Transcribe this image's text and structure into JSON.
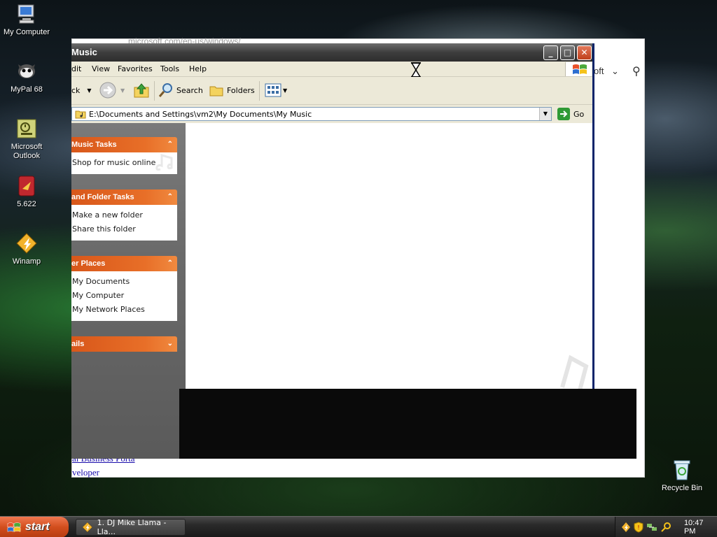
{
  "desktop": {
    "icons": [
      {
        "label": "My Computer",
        "icon": "computer-icon"
      },
      {
        "label": "MyPal 68",
        "icon": "mypal-icon"
      },
      {
        "label": "Microsoft Outlook",
        "icon": "outlook-icon"
      },
      {
        "label": "5.622",
        "icon": "app-icon"
      },
      {
        "label": "Winamp",
        "icon": "winamp-icon"
      },
      {
        "label": "Recycle Bin",
        "icon": "recycle-bin-icon"
      }
    ]
  },
  "background_browser": {
    "address_fragment": "microsoft.com/en-us/windows/",
    "header_fragment": "oft",
    "link_fragments": [
      "al Business Porta",
      "veloper"
    ]
  },
  "explorer": {
    "title": "Music",
    "menu": [
      "dit",
      "View",
      "Favorites",
      "Tools",
      "Help"
    ],
    "toolbar": {
      "back_label": "ck",
      "search_label": "Search",
      "folders_label": "Folders"
    },
    "address": {
      "value": "E:\\Documents and Settings\\vm2\\My Documents\\My Music",
      "go_label": "Go"
    },
    "panels": [
      {
        "title": "Music Tasks",
        "links": [
          "Shop for music online"
        ],
        "collapsed": false
      },
      {
        "title": "and Folder Tasks",
        "links": [
          "Make a new folder",
          "Share this folder"
        ],
        "collapsed": false
      },
      {
        "title": "er Places",
        "links": [
          "My Documents",
          "My Computer",
          "My Network Places"
        ],
        "collapsed": false
      },
      {
        "title": "ails",
        "links": [],
        "collapsed": true
      }
    ]
  },
  "taskbar": {
    "start_label": "start",
    "task_label": "1. DJ Mike Llama - Lla...",
    "clock": "10:47 PM"
  },
  "colors": {
    "panel_header": "#e0621f",
    "titlebar": "#4a4a4a",
    "start_button": "#d24e1d"
  }
}
